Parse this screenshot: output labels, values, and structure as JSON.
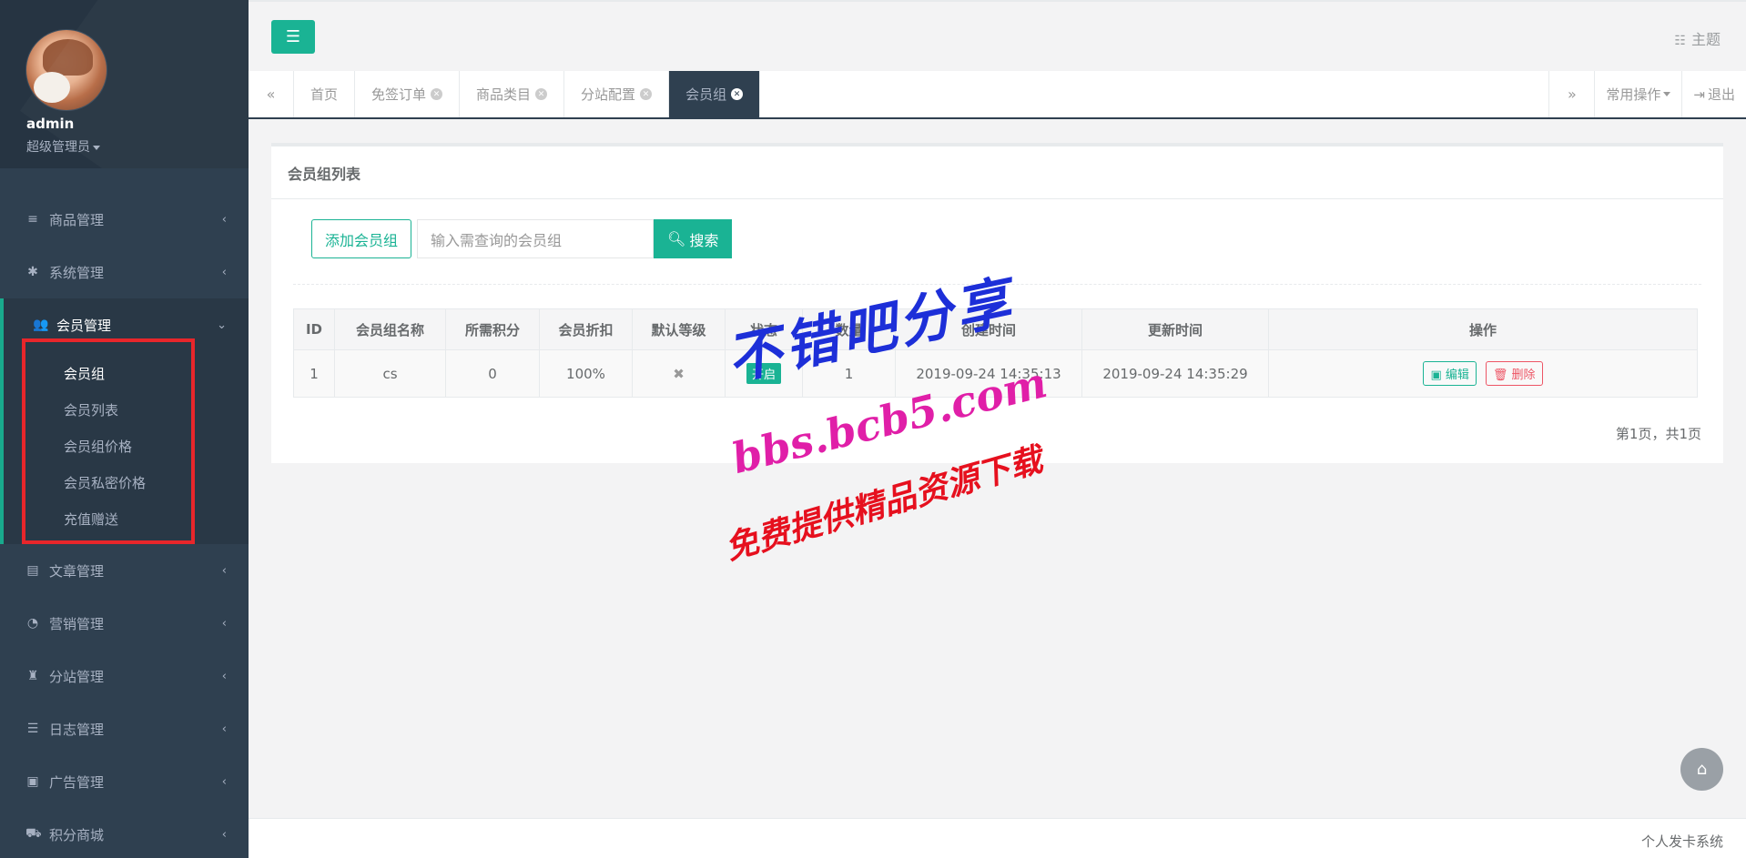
{
  "user": {
    "name": "admin",
    "role": "超级管理员"
  },
  "sidebar": {
    "items_top": [
      {
        "label": "商品管理",
        "icon": "list-icon",
        "glyph": "≡"
      },
      {
        "label": "系统管理",
        "icon": "gear-icon",
        "glyph": "✱"
      }
    ],
    "active": {
      "label": "会员管理",
      "icon": "users-icon",
      "glyph": "👥"
    },
    "submenu": [
      "会员组",
      "会员列表",
      "会员组价格",
      "会员私密价格",
      "充值赠送"
    ],
    "items_bottom": [
      {
        "label": "文章管理",
        "icon": "copy-icon",
        "glyph": "▤"
      },
      {
        "label": "营销管理",
        "icon": "pie-chart-icon",
        "glyph": "◔"
      },
      {
        "label": "分站管理",
        "icon": "shirt-icon",
        "glyph": "♜"
      },
      {
        "label": "日志管理",
        "icon": "server-icon",
        "glyph": "☰"
      },
      {
        "label": "广告管理",
        "icon": "image-icon",
        "glyph": "▣"
      },
      {
        "label": "积分商城",
        "icon": "cart-icon",
        "glyph": "⛟"
      }
    ]
  },
  "topbar": {
    "theme_label": "主题"
  },
  "tabs": {
    "items": [
      "首页",
      "免签订单",
      "商品类目",
      "分站配置",
      "会员组"
    ],
    "common_ops": "常用操作",
    "logout": "退出"
  },
  "panel": {
    "title": "会员组列表",
    "add_label": "添加会员组",
    "search_placeholder": "输入需查询的会员组",
    "search_label": "搜索"
  },
  "table": {
    "headers": [
      "ID",
      "会员组名称",
      "所需积分",
      "会员折扣",
      "默认等级",
      "状态",
      "数量",
      "创建时间",
      "更新时间",
      "操作"
    ],
    "rows": [
      {
        "id": "1",
        "name": "cs",
        "points": "0",
        "discount": "100%",
        "default_level": "✖",
        "status": "开启",
        "count": "1",
        "created": "2019-09-24 14:35:13",
        "updated": "2019-09-24 14:35:29",
        "edit": "编辑",
        "delete": "删除"
      }
    ]
  },
  "pager": "第1页，共1页",
  "watermark": {
    "line1": "不错吧分享",
    "line2": "bbs.bcb5.com",
    "line3": "免费提供精品资源下载"
  },
  "footer": "个人发卡系统",
  "colors": {
    "accent": "#1ab394",
    "sidebar": "#2f4050",
    "danger": "#ed5565",
    "highlight_box": "#e8262b"
  }
}
